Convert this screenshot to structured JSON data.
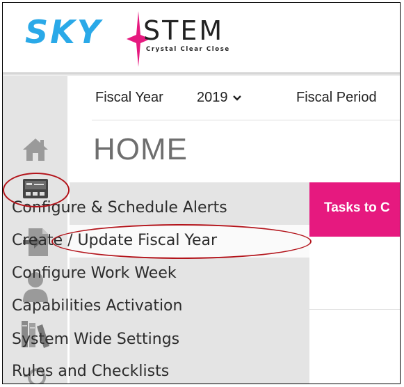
{
  "logo": {
    "sky_text": "SKY",
    "stem_text": "STEM",
    "tagline": "Crystal Clear Close",
    "sky_color": "#2aa9e8",
    "star_color": "#e6197f"
  },
  "filters": {
    "fiscal_year_label": "Fiscal Year",
    "fiscal_year_value": "2019",
    "fiscal_period_label": "Fiscal Period"
  },
  "page": {
    "title": "HOME"
  },
  "sidebar": {
    "icons": [
      "home-icon",
      "admin-panel-icon",
      "import-file-icon",
      "user-icon",
      "library-icon",
      "search-icon"
    ]
  },
  "menu": {
    "items": [
      "Configure & Schedule Alerts",
      "Create / Update Fiscal Year",
      "Configure Work Week",
      "Capabilities Activation",
      "System Wide Settings",
      "Rules and Checklists"
    ]
  },
  "tab_strip": {
    "label": "Tasks to C",
    "color": "#e6197f"
  },
  "annotation_color": "#b3141b"
}
